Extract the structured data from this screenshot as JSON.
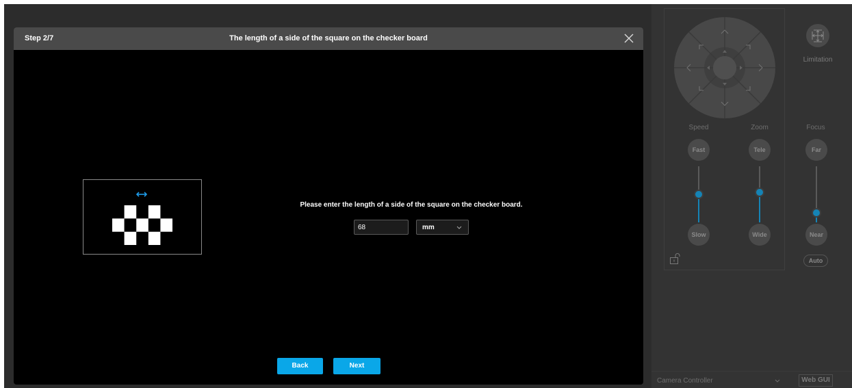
{
  "dialog": {
    "step": "Step 2/7",
    "title": "The length of a side of the square on the checker board",
    "close_icon": "close-icon",
    "prompt": "Please enter the length of a side of the square on the checker board.",
    "length_value": "68",
    "unit": "mm",
    "back_label": "Back",
    "next_label": "Next",
    "accent_color": "#0aa7e8"
  },
  "camera_panel": {
    "ptz_icon": "dpad-icon",
    "limitation_icon": "limitation-icon",
    "limitation_label": "Limitation",
    "speed": {
      "label": "Speed",
      "top_label": "Fast",
      "bottom_label": "Slow",
      "level": 0.5
    },
    "zoom": {
      "label": "Zoom",
      "top_label": "Tele",
      "bottom_label": "Wide",
      "level": 0.55
    },
    "focus": {
      "label": "Focus",
      "top_label": "Far",
      "bottom_label": "Near",
      "level": 0.1,
      "auto_label": "Auto"
    },
    "lock_icon": "unlock-icon",
    "mode_select": "Camera Controller",
    "webgui_label": "Web GUI"
  }
}
